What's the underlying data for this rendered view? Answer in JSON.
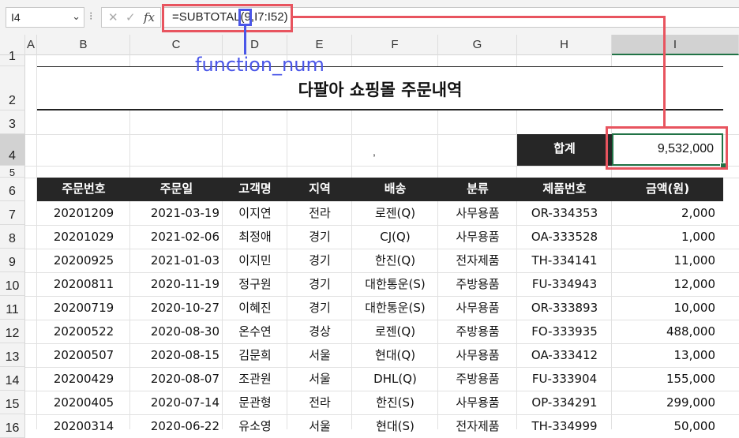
{
  "formula_bar": {
    "name_box": "I4",
    "formula": "=SUBTOTAL(9,I7:I52)",
    "fx_label": "fx"
  },
  "annotation": {
    "label": "function_num",
    "formula_highlight_color": "#e8545f",
    "argument_highlight_color": "#4a56e8"
  },
  "columns": [
    "A",
    "B",
    "C",
    "D",
    "E",
    "F",
    "G",
    "H",
    "I"
  ],
  "rows": [
    "1",
    "2",
    "3",
    "4",
    "5",
    "6",
    "7",
    "8",
    "9",
    "10",
    "11",
    "12",
    "13",
    "14",
    "15",
    "16"
  ],
  "sheet": {
    "title": "다팔아 쇼핑몰 주문내역",
    "total_label": "합계",
    "total_value": "9,532,000",
    "stray_text": ","
  },
  "table": {
    "headers": [
      "주문번호",
      "주문일",
      "고객명",
      "지역",
      "배송",
      "분류",
      "제품번호",
      "금액(원)"
    ],
    "rows": [
      [
        "20201209",
        "2021-03-19",
        "이지연",
        "전라",
        "로젠(Q)",
        "사무용품",
        "OR-334353",
        "2,000"
      ],
      [
        "20201029",
        "2021-02-06",
        "최정애",
        "경기",
        "CJ(Q)",
        "사무용품",
        "OA-333528",
        "1,000"
      ],
      [
        "20200925",
        "2021-01-03",
        "이지민",
        "경기",
        "한진(Q)",
        "전자제품",
        "TH-334141",
        "11,000"
      ],
      [
        "20200811",
        "2020-11-19",
        "정구원",
        "경기",
        "대한통운(S)",
        "주방용품",
        "FU-334943",
        "12,000"
      ],
      [
        "20200719",
        "2020-10-27",
        "이혜진",
        "경기",
        "대한통운(S)",
        "사무용품",
        "OR-333893",
        "10,000"
      ],
      [
        "20200522",
        "2020-08-30",
        "온수연",
        "경상",
        "로젠(Q)",
        "주방용품",
        "FO-333935",
        "488,000"
      ],
      [
        "20200507",
        "2020-08-15",
        "김문희",
        "서울",
        "현대(Q)",
        "사무용품",
        "OA-333412",
        "13,000"
      ],
      [
        "20200429",
        "2020-08-07",
        "조관원",
        "서울",
        "DHL(Q)",
        "주방용품",
        "FU-333904",
        "155,000"
      ],
      [
        "20200405",
        "2020-07-14",
        "문관형",
        "전라",
        "한진(S)",
        "사무용품",
        "OP-334291",
        "299,000"
      ],
      [
        "20200314",
        "2020-06-22",
        "유소영",
        "서울",
        "현대(S)",
        "전자제품",
        "TH-334999",
        "50,000"
      ]
    ]
  }
}
